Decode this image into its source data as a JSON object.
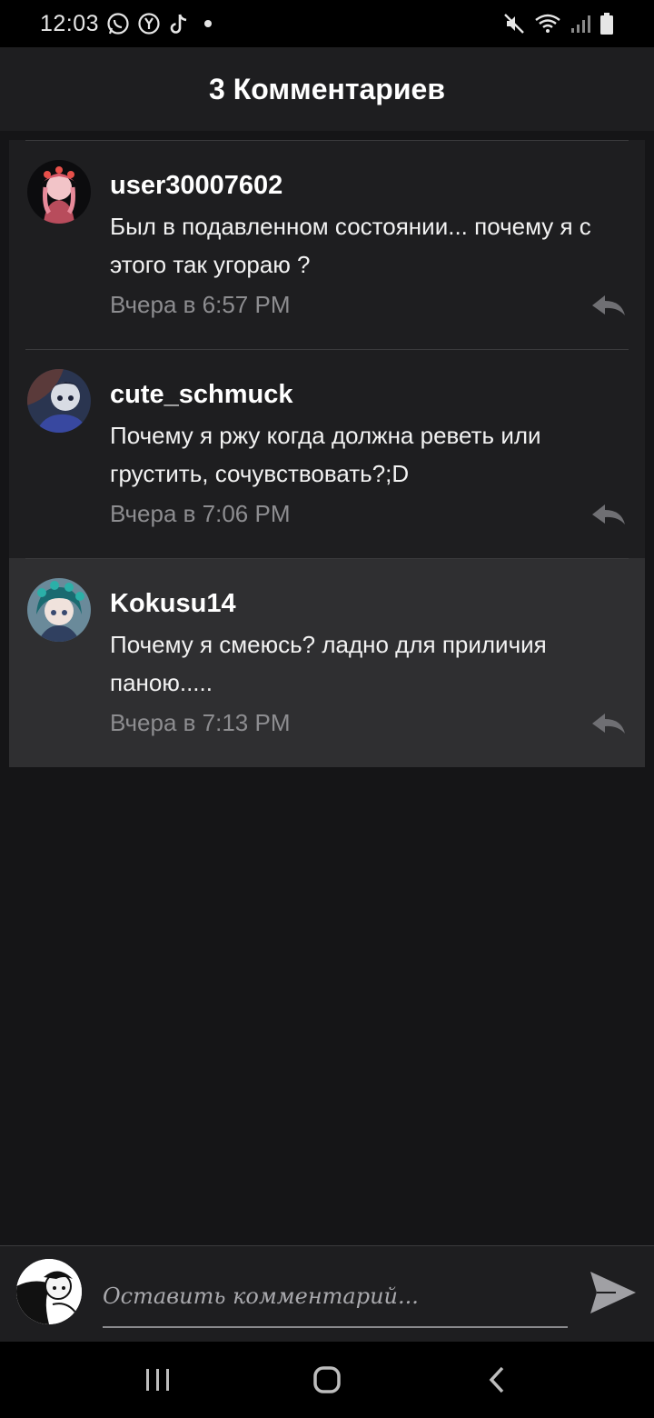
{
  "status_bar": {
    "time": "12:03",
    "left_icons": [
      "whatsapp-icon",
      "yandex-icon",
      "tiktok-icon",
      "dot-icon"
    ],
    "right_icons": [
      "mute-icon",
      "wifi-icon",
      "signal-icon",
      "battery-icon"
    ]
  },
  "header": {
    "title": "3 Комментариев"
  },
  "comments": [
    {
      "username": "user30007602",
      "text": "Был в подавленном состоянии... почему я с этого так угораю ?",
      "timestamp": "Вчера в 6:57 PM",
      "highlighted": false
    },
    {
      "username": "cute_schmuck",
      "text": "Почему я ржу когда должна реветь или грустить, сочувствовать?;D",
      "timestamp": "Вчера в 7:06 PM",
      "highlighted": false
    },
    {
      "username": "Kokusu14",
      "text": "Почему я смеюсь? ладно для приличия паною.....",
      "timestamp": "Вчера в 7:13 PM",
      "highlighted": true
    }
  ],
  "input": {
    "placeholder": "Оставить комментарий..."
  },
  "colors": {
    "background": "#151517",
    "card": "#1e1e20",
    "highlight": "#2f2f31",
    "muted_text": "#8d8d90"
  }
}
